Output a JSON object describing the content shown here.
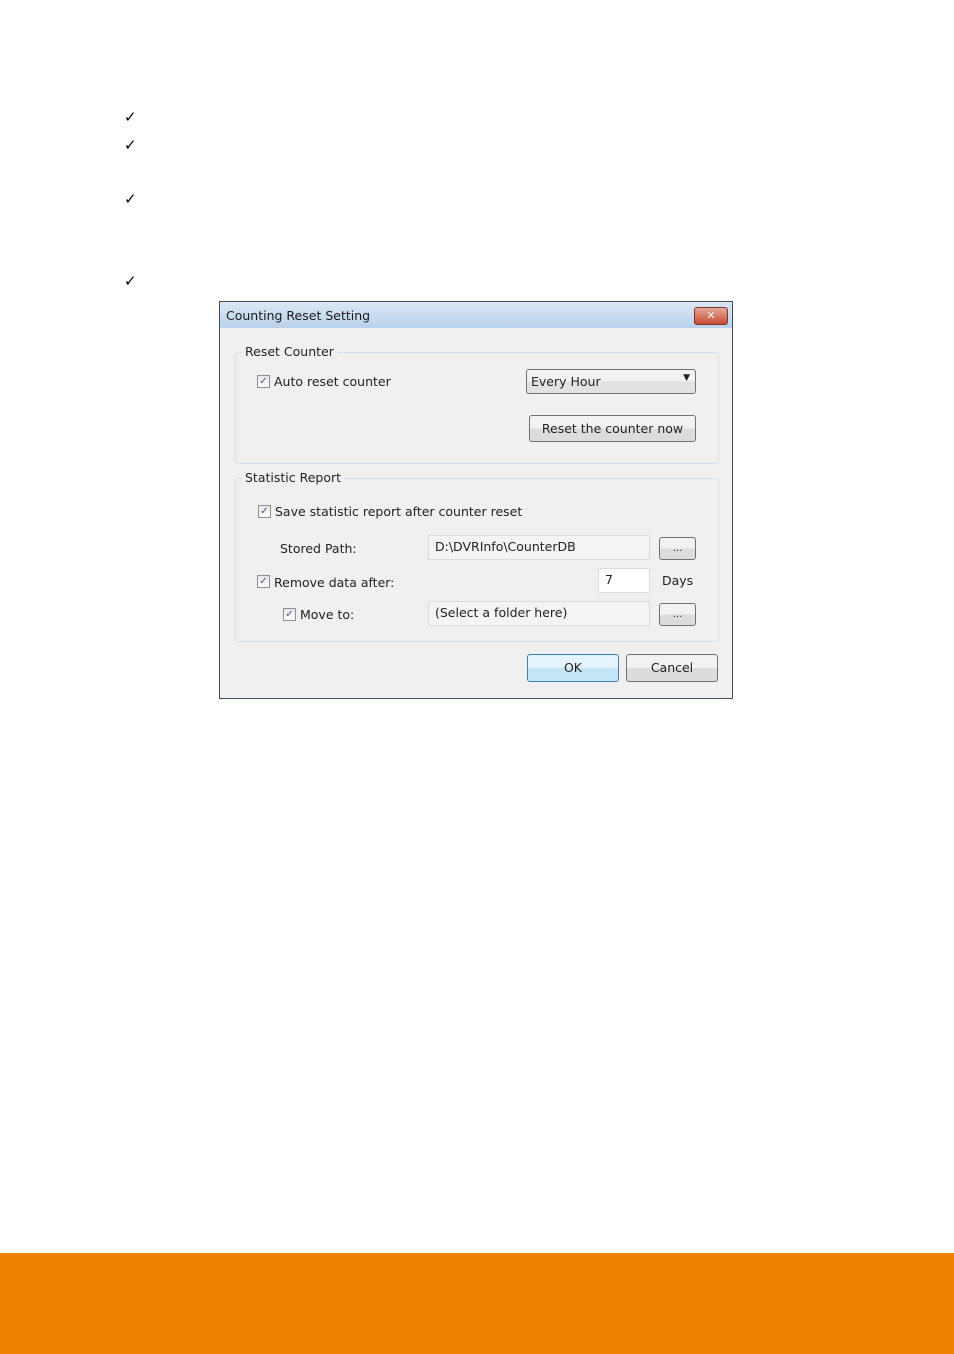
{
  "bullets": {
    "icon": "checkmark-icon",
    "marks": [
      "✓",
      "✓",
      "✓",
      "✓"
    ]
  },
  "dialog": {
    "title": "Counting Reset Setting",
    "close_label": "✕",
    "reset_counter": {
      "group_label": "Reset Counter",
      "auto_reset_label": "Auto reset counter",
      "auto_reset_checked": true,
      "interval_selected": "Every Hour",
      "reset_now_label": "Reset the counter now"
    },
    "statistic_report": {
      "group_label": "Statistic Report",
      "save_report_label": "Save statistic report after counter reset",
      "save_report_checked": true,
      "stored_path_label": "Stored Path:",
      "stored_path_value": "D:\\DVRInfo\\CounterDB",
      "browse_label": "...",
      "remove_data_label": "Remove data after:",
      "remove_data_checked": true,
      "days_value": "7",
      "days_unit": "Days",
      "move_to_label": "Move to:",
      "move_to_checked": true,
      "move_to_placeholder": "(Select a folder here)"
    },
    "ok_label": "OK",
    "cancel_label": "Cancel"
  },
  "footer_color": "#EE8300"
}
